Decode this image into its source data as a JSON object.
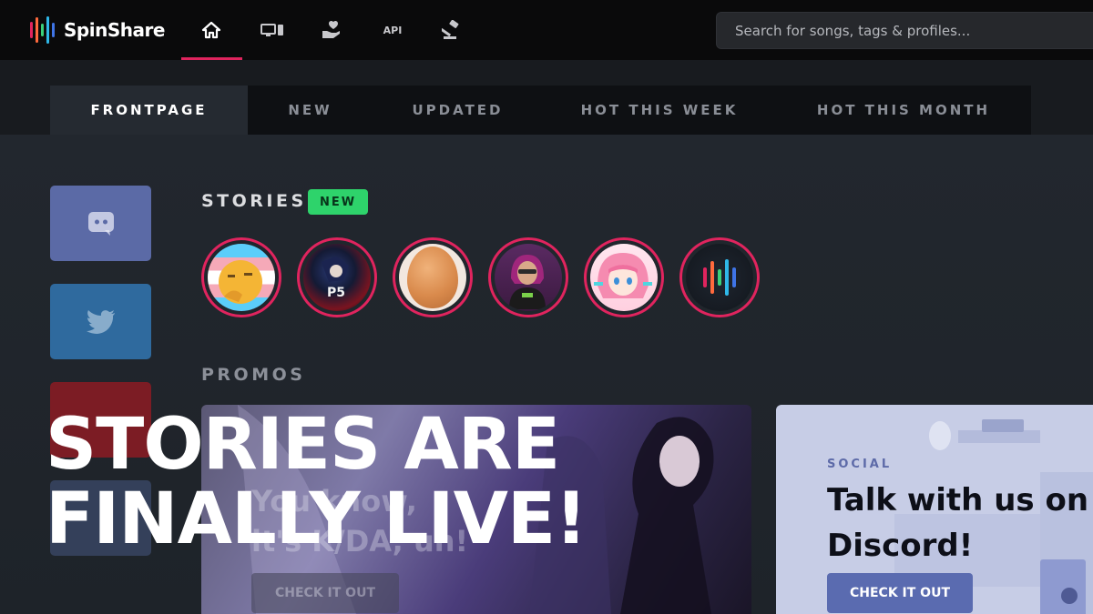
{
  "app": {
    "name": "SpinShare"
  },
  "nav": {
    "icons": [
      "home-icon",
      "devices-icon",
      "heart-hand-icon",
      "api-icon",
      "gavel-icon"
    ],
    "api_label": "API",
    "active": "home"
  },
  "search": {
    "placeholder": "Search for songs, tags & profiles..."
  },
  "tabs": [
    {
      "label": "FRONTPAGE",
      "active": true
    },
    {
      "label": "NEW",
      "active": false
    },
    {
      "label": "UPDATED",
      "active": false
    },
    {
      "label": "HOT THIS WEEK",
      "active": false
    },
    {
      "label": "HOT THIS MONTH",
      "active": false
    }
  ],
  "sidebar": {
    "buttons": [
      {
        "name": "discord",
        "icon": "discord-icon",
        "color": "#5b6aa6"
      },
      {
        "name": "twitter",
        "icon": "twitter-icon",
        "color": "#2f6a9e"
      },
      {
        "name": "youtube",
        "icon": "youtube-icon",
        "color": "#7c1c24"
      },
      {
        "name": "other",
        "icon": "link-icon",
        "color": "#34405a"
      }
    ]
  },
  "stories": {
    "title": "STORIES",
    "badge": "NEW",
    "items": [
      "story-avatar-1",
      "story-avatar-2",
      "story-avatar-3",
      "story-avatar-4",
      "story-avatar-5",
      "story-avatar-6"
    ]
  },
  "promos": {
    "title": "PROMOS",
    "kda": {
      "text_line1": "You know,",
      "text_line2": "it's K/DA, uh!",
      "button": "CHECK IT OUT"
    },
    "discord": {
      "kicker": "SOCIAL",
      "title": "Talk with us on Discord!",
      "button": "CHECK IT OUT"
    }
  },
  "headline": {
    "line1": "STORIES ARE",
    "line2": "FINALLY LIVE!"
  },
  "colors": {
    "accent": "#e0245e",
    "badge": "#2ed36b",
    "discord": "#5a6bb0"
  }
}
